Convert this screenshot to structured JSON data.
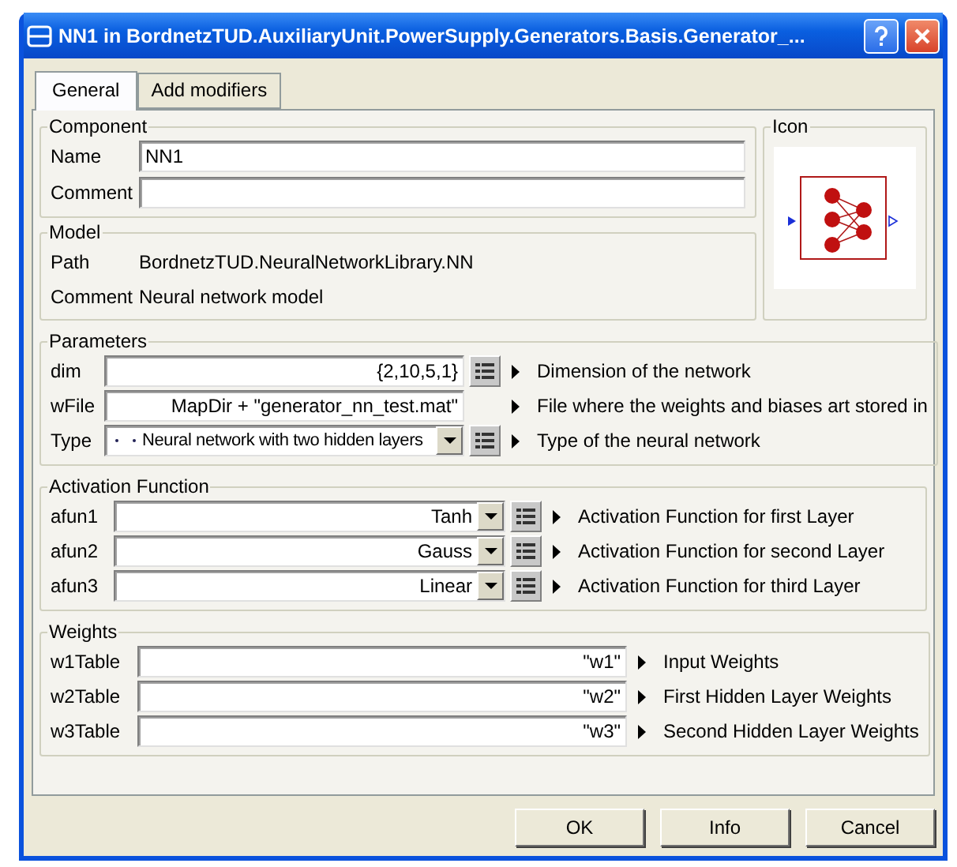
{
  "window": {
    "title": "NN1 in BordnetzTUD.AuxiliaryUnit.PowerSupply.Generators.Basis.Generator_..."
  },
  "tabs": [
    {
      "label": "General",
      "selected": true
    },
    {
      "label": "Add modifiers",
      "selected": false
    }
  ],
  "component": {
    "title": "Component",
    "fields": [
      {
        "label": "Name",
        "value": "NN1"
      },
      {
        "label": "Comment"
      }
    ]
  },
  "icon_panel": {
    "title": "Icon"
  },
  "model": {
    "title": "Model",
    "rows": [
      {
        "label": "Path",
        "value": "BordnetzTUD.NeuralNetworkLibrary.NN"
      },
      {
        "label": "Comment",
        "value": "Neural network model"
      }
    ]
  },
  "groups": [
    {
      "title": "Parameters",
      "rows": [
        {
          "label": "dim",
          "kind": "field",
          "value": "{2,10,5,1}",
          "edit_button": true,
          "description": "Dimension of the network"
        },
        {
          "label": "wFile",
          "kind": "field",
          "value": "MapDir + \"generator_nn_test.mat\"",
          "edit_button": false,
          "description": "File where the weights and biases art stored in"
        },
        {
          "label": "Type",
          "kind": "enum",
          "value": "Neural network with two hidden layers",
          "edit_button": true,
          "description": "Type of the neural network"
        }
      ]
    },
    {
      "title": "Activation Function",
      "rows": [
        {
          "label": "afun1",
          "kind": "dropdown",
          "value": "Tanh",
          "edit_button": true,
          "description": "Activation Function for first Layer"
        },
        {
          "label": "afun2",
          "kind": "dropdown",
          "value": "Gauss",
          "edit_button": true,
          "description": "Activation Function for second Layer"
        },
        {
          "label": "afun3",
          "kind": "dropdown",
          "value": "Linear",
          "edit_button": true,
          "description": "Activation Function for third Layer"
        }
      ]
    },
    {
      "title": "Weights",
      "rows": [
        {
          "label": "w1Table",
          "kind": "field",
          "value": "\"w1\"",
          "edit_button": false,
          "description": "Input Weights"
        },
        {
          "label": "w2Table",
          "kind": "field",
          "value": "\"w2\"",
          "edit_button": false,
          "description": "First Hidden Layer Weights"
        },
        {
          "label": "w3Table",
          "kind": "field",
          "value": "\"w3\"",
          "edit_button": false,
          "description": "Second Hidden Layer Weights"
        }
      ]
    }
  ],
  "buttons": [
    "OK",
    "Info",
    "Cancel"
  ]
}
